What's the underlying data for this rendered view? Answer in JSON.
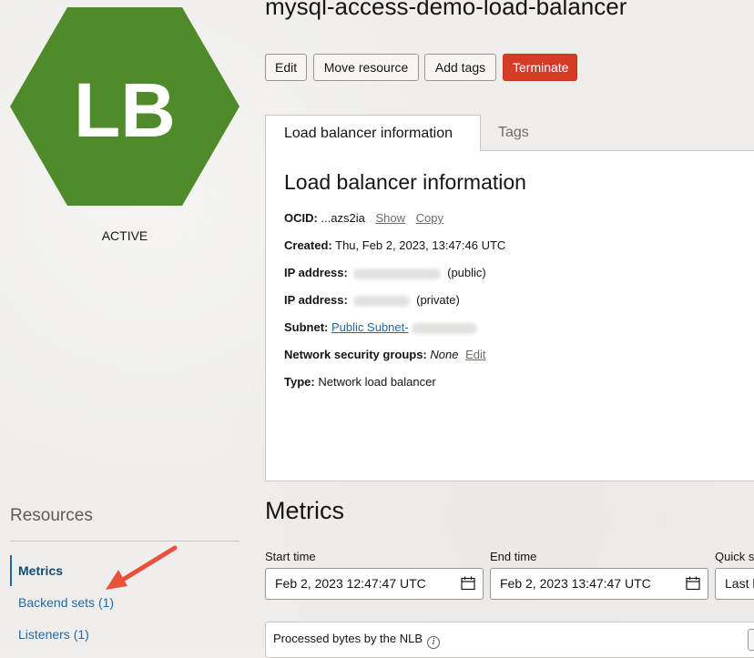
{
  "resource": {
    "initials": "LB",
    "status": "ACTIVE",
    "name": "mysql-access-demo-load-balancer",
    "avatar_color": "#4f8a2b"
  },
  "actions": {
    "edit": "Edit",
    "move": "Move resource",
    "add_tags": "Add tags",
    "terminate": "Terminate",
    "terminate_color": "#d63b25"
  },
  "tabs": {
    "active": "Load balancer information",
    "tags": "Tags"
  },
  "info": {
    "heading": "Load balancer information",
    "ocid_label": "OCID:",
    "ocid_value": "...azs2ia",
    "show": "Show",
    "copy": "Copy",
    "created_label": "Created:",
    "created_value": "Thu, Feb 2, 2023, 13:47:46 UTC",
    "ip_label": "IP address:",
    "ip_public_suffix": "(public)",
    "ip_private_suffix": "(private)",
    "subnet_label": "Subnet:",
    "subnet_value": "Public Subnet-",
    "nsg_label": "Network security groups:",
    "nsg_value": "None",
    "nsg_edit": "Edit",
    "type_label": "Type:",
    "type_value": "Network load balancer"
  },
  "resources": {
    "title": "Resources",
    "items": [
      {
        "label": "Metrics"
      },
      {
        "label": "Backend sets (1)"
      },
      {
        "label": "Listeners (1)"
      }
    ],
    "link_color": "#1e6aa8"
  },
  "metrics": {
    "heading": "Metrics",
    "start_label": "Start time",
    "start_value": "Feb 2, 2023 12:47:47 UTC",
    "end_label": "End time",
    "end_value": "Feb 2, 2023 13:47:47 UTC",
    "quick_label": "Quick s",
    "quick_value": "Last h",
    "chart_title": "Processed bytes by the NLB",
    "info_glyph": "i"
  },
  "annotation": {
    "arrow_color": "#e8513c"
  }
}
